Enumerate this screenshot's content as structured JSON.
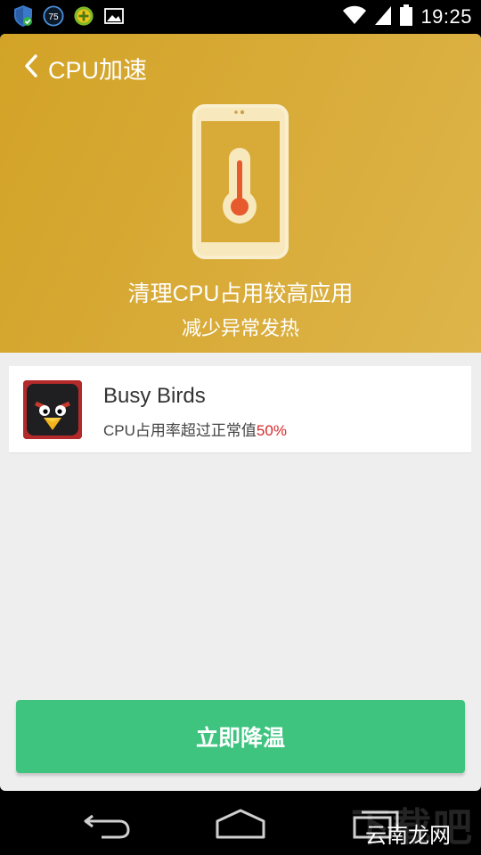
{
  "status_bar": {
    "time": "19:25",
    "left_icons": [
      "shield-check-icon",
      "badge-75-icon",
      "plus-circle-icon",
      "image-icon"
    ],
    "badge_number": "75",
    "right_icons": [
      "wifi-icon",
      "signal-icon",
      "battery-icon"
    ]
  },
  "header": {
    "back_icon": "chevron-left-icon",
    "title": "CPU加速"
  },
  "hero": {
    "illustration": "phone-thermometer-icon",
    "title": "清理CPU占用较高应用",
    "subtitle": "减少异常发热"
  },
  "apps": [
    {
      "name": "Busy Birds",
      "desc_prefix": "CPU占用率超过正常值",
      "desc_percent": "50%",
      "icon": "angry-bird-icon"
    }
  ],
  "action": {
    "cool_label": "立即降温"
  },
  "nav_bar": {
    "icons": [
      "back-arrow-icon",
      "home-icon",
      "recent-apps-icon"
    ]
  },
  "watermark": {
    "text": "云南龙网",
    "ghost_text": "下载吧"
  },
  "colors": {
    "hero": "#d4a52c",
    "accent_green": "#3ec47f",
    "alert_red": "#d9282a"
  }
}
